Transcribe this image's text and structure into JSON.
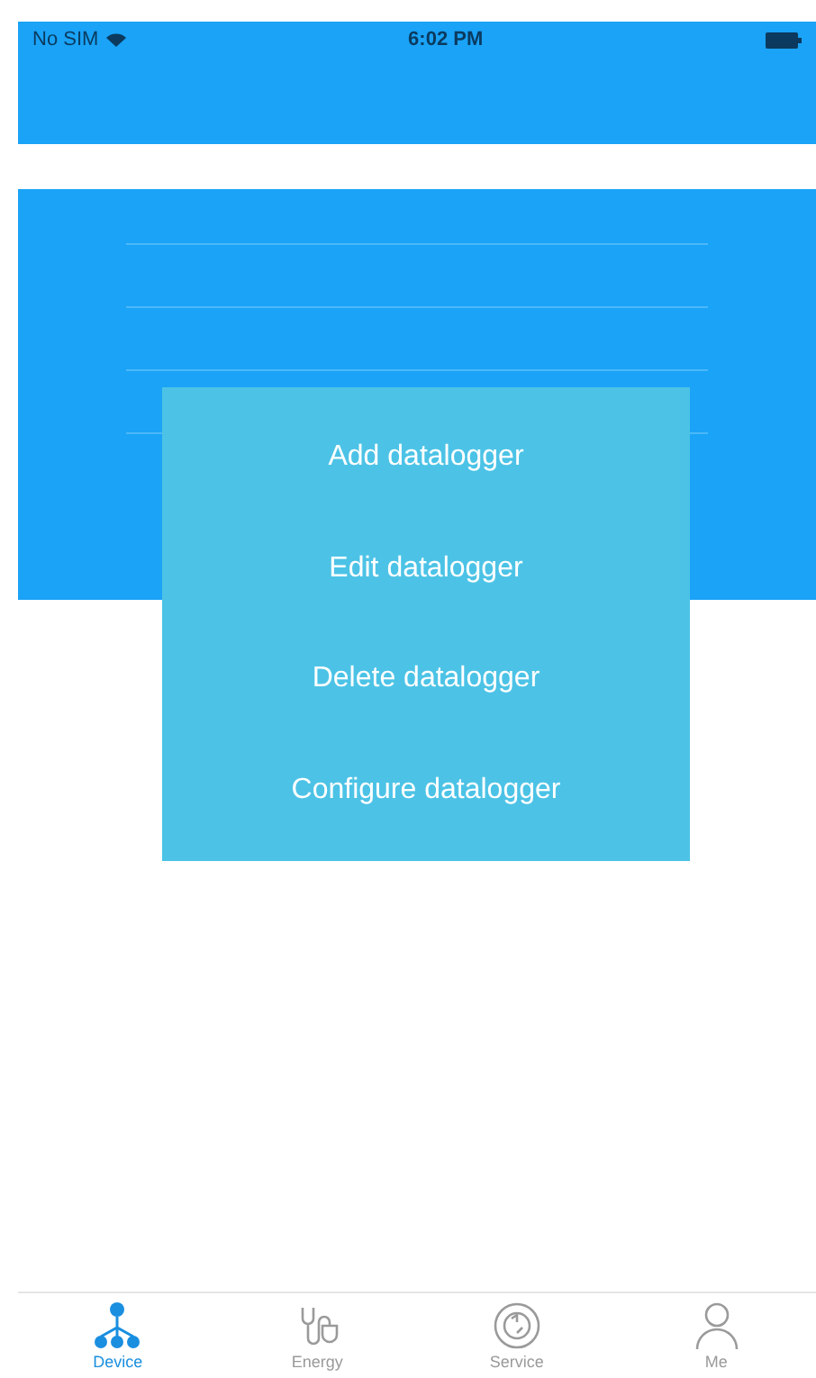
{
  "status_bar": {
    "carrier": "No SIM",
    "time": "6:02 PM"
  },
  "menu": {
    "items": [
      {
        "label": "Add datalogger"
      },
      {
        "label": "Edit datalogger"
      },
      {
        "label": "Delete datalogger"
      },
      {
        "label": "Configure datalogger"
      }
    ]
  },
  "tab_bar": {
    "tabs": [
      {
        "label": "Device",
        "kind": "device",
        "selected": true
      },
      {
        "label": "Energy",
        "kind": "energy",
        "selected": false
      },
      {
        "label": "Service",
        "kind": "service",
        "selected": false
      },
      {
        "label": "Me",
        "kind": "me",
        "selected": false
      }
    ]
  }
}
